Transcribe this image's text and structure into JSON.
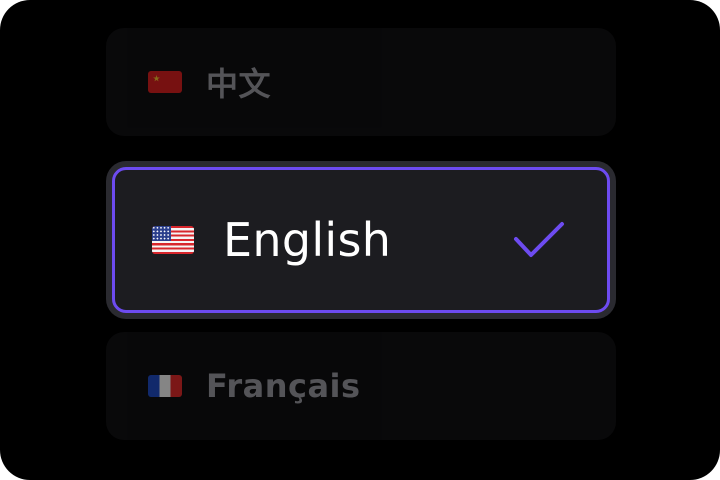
{
  "options": [
    {
      "flag_icon": "china-flag-icon",
      "label": "中文",
      "selected": false
    },
    {
      "flag_icon": "us-flag-icon",
      "label": "English",
      "selected": true
    },
    {
      "flag_icon": "france-flag-icon",
      "label": "Français",
      "selected": false
    }
  ],
  "selected_check_icon": "checkmark-icon",
  "colors": {
    "accent": "#6d4bf0",
    "background": "#000000",
    "card": "#1c1c20"
  }
}
